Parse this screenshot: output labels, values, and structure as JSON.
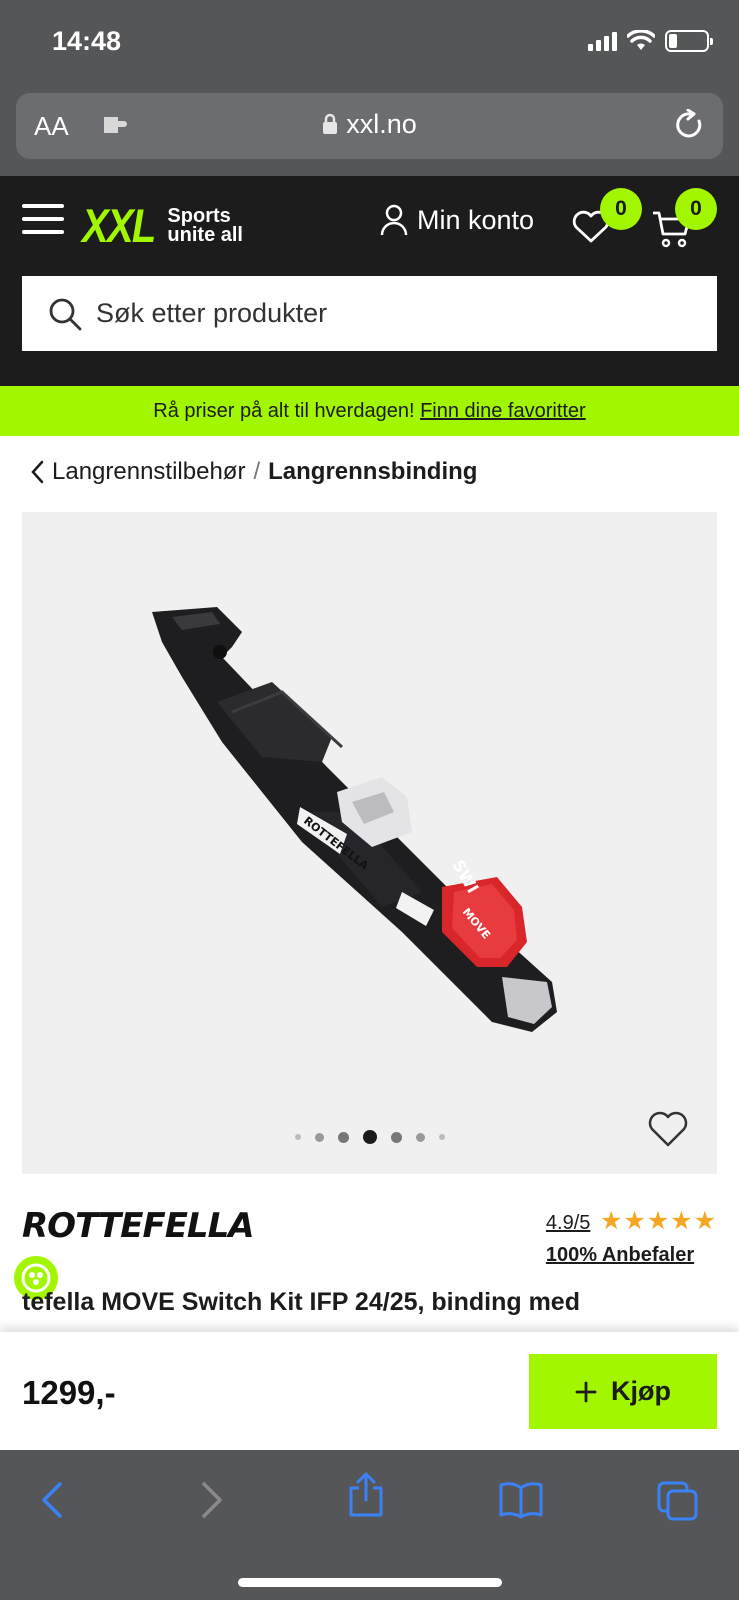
{
  "status_bar": {
    "time": "14:48"
  },
  "browser": {
    "aa_label": "AA",
    "url": "xxl.no"
  },
  "header": {
    "logo_text": "XXL",
    "logo_tagline_1": "Sports",
    "logo_tagline_2": "unite all",
    "account_label": "Min konto",
    "wishlist_count": "0",
    "cart_count": "0",
    "search_placeholder": "Søk etter produkter"
  },
  "promo": {
    "text": "Rå priser på alt til hverdagen!",
    "link": "Finn dine favoritter"
  },
  "breadcrumb": {
    "parent": "Langrennstilbehør",
    "separator": "/",
    "current": "Langrennsbinding"
  },
  "gallery": {
    "image_count": 7,
    "active_index": 3
  },
  "product": {
    "brand": "ROTTEFELLA",
    "rating": "4.9/5",
    "stars": "★★★★★",
    "recommend": "100% Anbefaler",
    "title_visible": "tefella MOVE Switch Kit IFP 24/25, binding med"
  },
  "buy_bar": {
    "price": "1299,-",
    "buy_label": "Kjøp"
  },
  "colors": {
    "brand_green": "#a1f600",
    "header_bg": "#1c1c1c",
    "star": "#f5a623",
    "ios_blue": "#3b82f6"
  }
}
